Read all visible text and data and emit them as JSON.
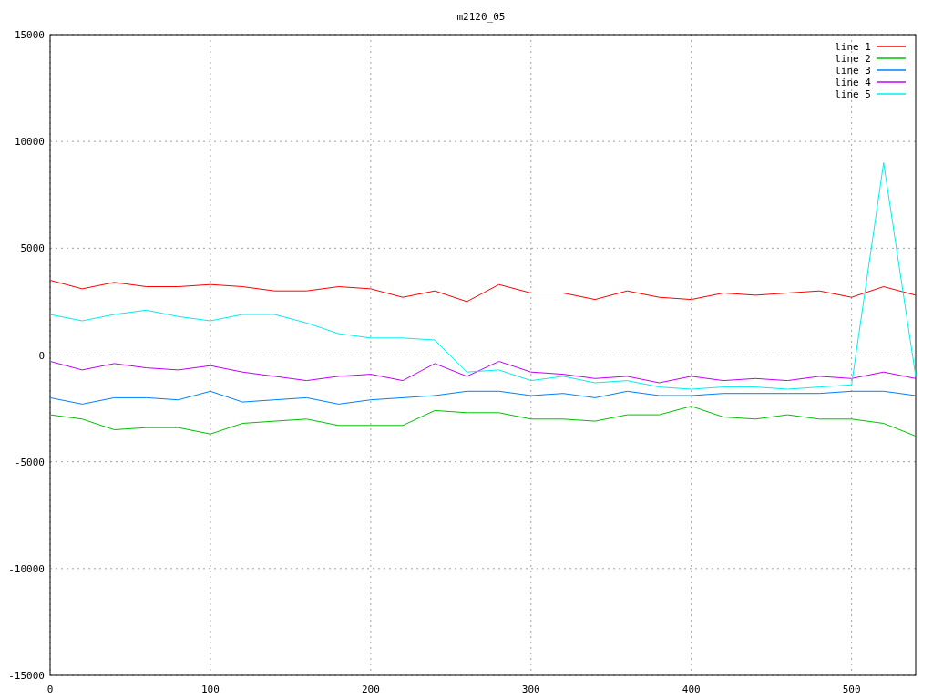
{
  "chart_data": {
    "type": "line",
    "title": "m2120_05",
    "x": [
      0,
      20,
      40,
      60,
      80,
      100,
      120,
      140,
      160,
      180,
      200,
      220,
      240,
      260,
      280,
      300,
      320,
      340,
      360,
      380,
      400,
      420,
      440,
      460,
      480,
      500,
      520,
      540
    ],
    "xlim": [
      0,
      540
    ],
    "ylim": [
      -15000,
      15000
    ],
    "xticks": [
      0,
      100,
      200,
      300,
      400,
      500
    ],
    "yticks": [
      -15000,
      -10000,
      -5000,
      0,
      5000,
      10000,
      15000
    ],
    "grid": true,
    "legend": true,
    "series": [
      {
        "name": "line 1",
        "color": "#ff0000",
        "values": [
          3500,
          3100,
          3400,
          3200,
          3200,
          3300,
          3200,
          3000,
          3000,
          3200,
          3100,
          2700,
          3000,
          2500,
          3300,
          2900,
          2900,
          2600,
          3000,
          2700,
          2600,
          2900,
          2800,
          2900,
          3000,
          2700,
          3200,
          2800
        ]
      },
      {
        "name": "line 2",
        "color": "#00c000",
        "values": [
          -2800,
          -3000,
          -3500,
          -3400,
          -3400,
          -3700,
          -3200,
          -3100,
          -3000,
          -3300,
          -3300,
          -3300,
          -2600,
          -2700,
          -2700,
          -3000,
          -3000,
          -3100,
          -2800,
          -2800,
          -2400,
          -2900,
          -3000,
          -2800,
          -3000,
          -3000,
          -3200,
          -3800
        ]
      },
      {
        "name": "line 3",
        "color": "#0080ff",
        "values": [
          -2000,
          -2300,
          -2000,
          -2000,
          -2100,
          -1700,
          -2200,
          -2100,
          -2000,
          -2300,
          -2100,
          -2000,
          -1900,
          -1700,
          -1700,
          -1900,
          -1800,
          -2000,
          -1700,
          -1900,
          -1900,
          -1800,
          -1800,
          -1800,
          -1800,
          -1700,
          -1700,
          -1900
        ]
      },
      {
        "name": "line 4",
        "color": "#c000ff",
        "values": [
          -300,
          -700,
          -400,
          -600,
          -700,
          -500,
          -800,
          -1000,
          -1200,
          -1000,
          -900,
          -1200,
          -400,
          -1000,
          -300,
          -800,
          -900,
          -1100,
          -1000,
          -1300,
          -1000,
          -1200,
          -1100,
          -1200,
          -1000,
          -1100,
          -800,
          -1100
        ]
      },
      {
        "name": "line 5",
        "color": "#00eeee",
        "values": [
          1900,
          1600,
          1900,
          2100,
          1800,
          1600,
          1900,
          1900,
          1500,
          1000,
          800,
          800,
          700,
          -800,
          -700,
          -1200,
          -1000,
          -1300,
          -1200,
          -1500,
          -1600,
          -1500,
          -1500,
          -1600,
          -1500,
          -1400,
          9000,
          -1000
        ]
      }
    ]
  }
}
